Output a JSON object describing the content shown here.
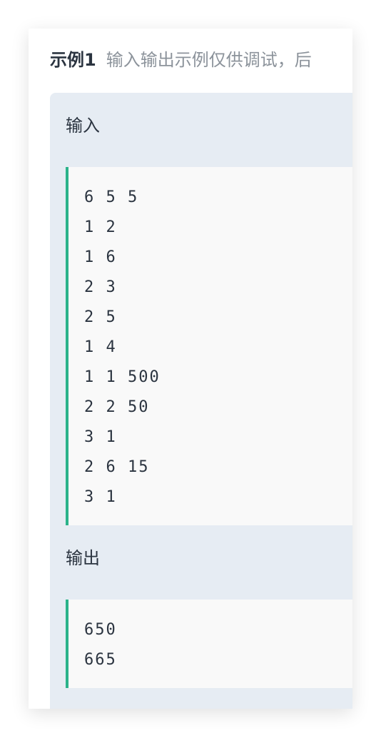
{
  "example": {
    "title": "示例1",
    "note": "输入输出示例仅供调试，后"
  },
  "input": {
    "label": "输入",
    "lines": [
      "6 5 5",
      "1 2",
      "1 6",
      "2 3",
      "2 5",
      "1 4",
      "1 1 500",
      "2 2 50",
      "3 1",
      "2 6 15",
      "3 1"
    ]
  },
  "output": {
    "label": "输出",
    "lines": [
      "650",
      "665"
    ]
  },
  "colors": {
    "accent": "#2bb38a",
    "panel": "#e6ecf3",
    "code_bg": "#f9f9f9"
  }
}
